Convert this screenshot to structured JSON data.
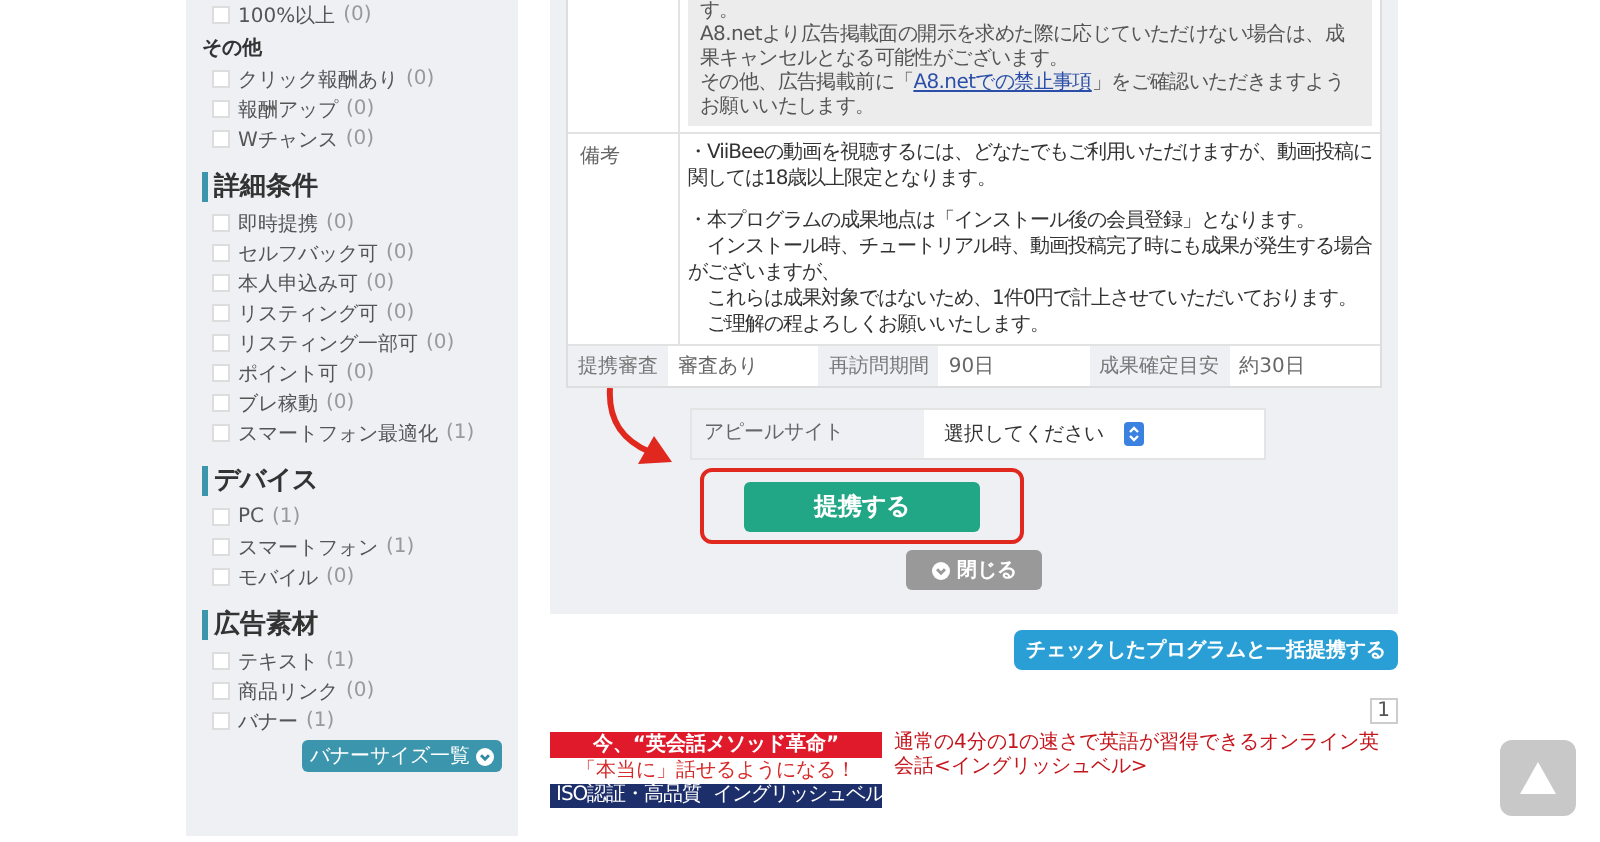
{
  "sidebar": {
    "groups": [
      {
        "kind": "plain",
        "items": [
          {
            "label": "100%以上",
            "count": "(0)",
            "checked": false
          }
        ]
      },
      {
        "kind": "subheading",
        "title": "その他",
        "items": [
          {
            "label": "クリック報酬あり",
            "count": "(0)",
            "checked": false
          },
          {
            "label": "報酬アップ",
            "count": "(0)",
            "checked": false
          },
          {
            "label": "Wチャンス",
            "count": "(0)",
            "checked": false
          }
        ]
      },
      {
        "kind": "heading",
        "title": "詳細条件",
        "items": [
          {
            "label": "即時提携",
            "count": "(0)",
            "checked": false
          },
          {
            "label": "セルフバック可",
            "count": "(0)",
            "checked": false
          },
          {
            "label": "本人申込み可",
            "count": "(0)",
            "checked": false
          },
          {
            "label": "リスティング可",
            "count": "(0)",
            "checked": false
          },
          {
            "label": "リスティング一部可",
            "count": "(0)",
            "checked": false
          },
          {
            "label": "ポイント可",
            "count": "(0)",
            "checked": false
          },
          {
            "label": "ブレ稼動",
            "count": "(0)",
            "checked": false
          },
          {
            "label": "スマートフォン最適化",
            "count": "(1)",
            "checked": false
          }
        ]
      },
      {
        "kind": "heading",
        "title": "デバイス",
        "items": [
          {
            "label": "PC",
            "count": "(1)",
            "checked": false
          },
          {
            "label": "スマートフォン",
            "count": "(1)",
            "checked": false
          },
          {
            "label": "モバイル",
            "count": "(0)",
            "checked": false
          }
        ]
      },
      {
        "kind": "heading",
        "title": "広告素材",
        "items": [
          {
            "label": "テキスト",
            "count": "(1)",
            "checked": false
          },
          {
            "label": "商品リンク",
            "count": "(0)",
            "checked": false
          },
          {
            "label": "バナー",
            "count": "(1)",
            "checked": false
          }
        ]
      }
    ],
    "banner_size_button": "バナーサイズ一覧"
  },
  "notice": {
    "lines": [
      {
        "text": "す。"
      },
      {
        "text": "A8.netより広告掲載面の開示を求めた際に応じていただけない場合は、成果キャンセルとなる可能性がございます。"
      },
      {
        "text": "その他、広告掲載前に「",
        "link": "A8.netでの禁止事項",
        "after": "」をご確認いただきますようお願いいたします。"
      }
    ]
  },
  "remarks": {
    "label": "備考",
    "paragraphs": [
      "・ViiBeeの動画を視聴するには、どなたでもご利用いただけますが、動画投稿に関しては18歳以上限定となります。",
      "・本プログラムの成果地点は「インストール後の会員登録」となります。",
      "　インストール時、チュートリアル時、動画投稿完了時にも成果が発生する場合がございますが、",
      "　これらは成果対象ではないため、1件0円で計上させていただいております。",
      "　ご理解の程よろしくお願いいたします。"
    ]
  },
  "terms": [
    {
      "label": "提携審査",
      "value": "審査あり"
    },
    {
      "label": "再訪問期間",
      "value": "90日"
    },
    {
      "label": "成果確定目安",
      "value": "約30日"
    }
  ],
  "appeal": {
    "label": "アピールサイト",
    "value": "選択してください"
  },
  "apply_button": "提携する",
  "close_button": "閉じる",
  "bulk_button": "チェックしたプログラムと一括提携する",
  "page": "1",
  "ad": {
    "banner_headline": "今、“英会話メソッド革命”",
    "banner_sub": "「本当に」話せるようになる！",
    "banner_badge": "ISO認証・高品質",
    "banner_brand": "イングリッシュベル",
    "link": "通常の4分の1の速さで英語が習得できるオンライン英会話<イングリッシュベル>"
  }
}
